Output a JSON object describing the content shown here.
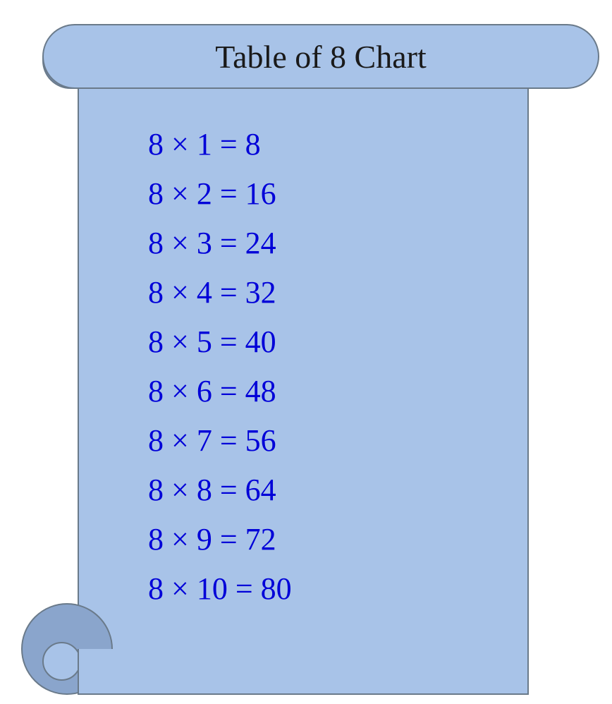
{
  "title": "Table of 8 Chart",
  "rows": [
    {
      "text": "8 × 1 = 8"
    },
    {
      "text": "8 × 2 = 16"
    },
    {
      "text": "8 × 3 = 24"
    },
    {
      "text": "8 × 4 = 32"
    },
    {
      "text": "8 × 5 = 40"
    },
    {
      "text": "8 × 6 = 48"
    },
    {
      "text": "8 × 7 = 56"
    },
    {
      "text": "8 × 8 = 64"
    },
    {
      "text": "8 × 9 = 72"
    },
    {
      "text": "8 × 10 = 80"
    }
  ],
  "chart_data": {
    "type": "table",
    "title": "Table of 8 Chart",
    "multiplicand": 8,
    "multipliers": [
      1,
      2,
      3,
      4,
      5,
      6,
      7,
      8,
      9,
      10
    ],
    "products": [
      8,
      16,
      24,
      32,
      40,
      48,
      56,
      64,
      72,
      80
    ],
    "equations": [
      {
        "a": 8,
        "b": 1,
        "result": 8
      },
      {
        "a": 8,
        "b": 2,
        "result": 16
      },
      {
        "a": 8,
        "b": 3,
        "result": 24
      },
      {
        "a": 8,
        "b": 4,
        "result": 32
      },
      {
        "a": 8,
        "b": 5,
        "result": 40
      },
      {
        "a": 8,
        "b": 6,
        "result": 48
      },
      {
        "a": 8,
        "b": 7,
        "result": 56
      },
      {
        "a": 8,
        "b": 8,
        "result": 64
      },
      {
        "a": 8,
        "b": 9,
        "result": 72
      },
      {
        "a": 8,
        "b": 10,
        "result": 80
      }
    ]
  }
}
